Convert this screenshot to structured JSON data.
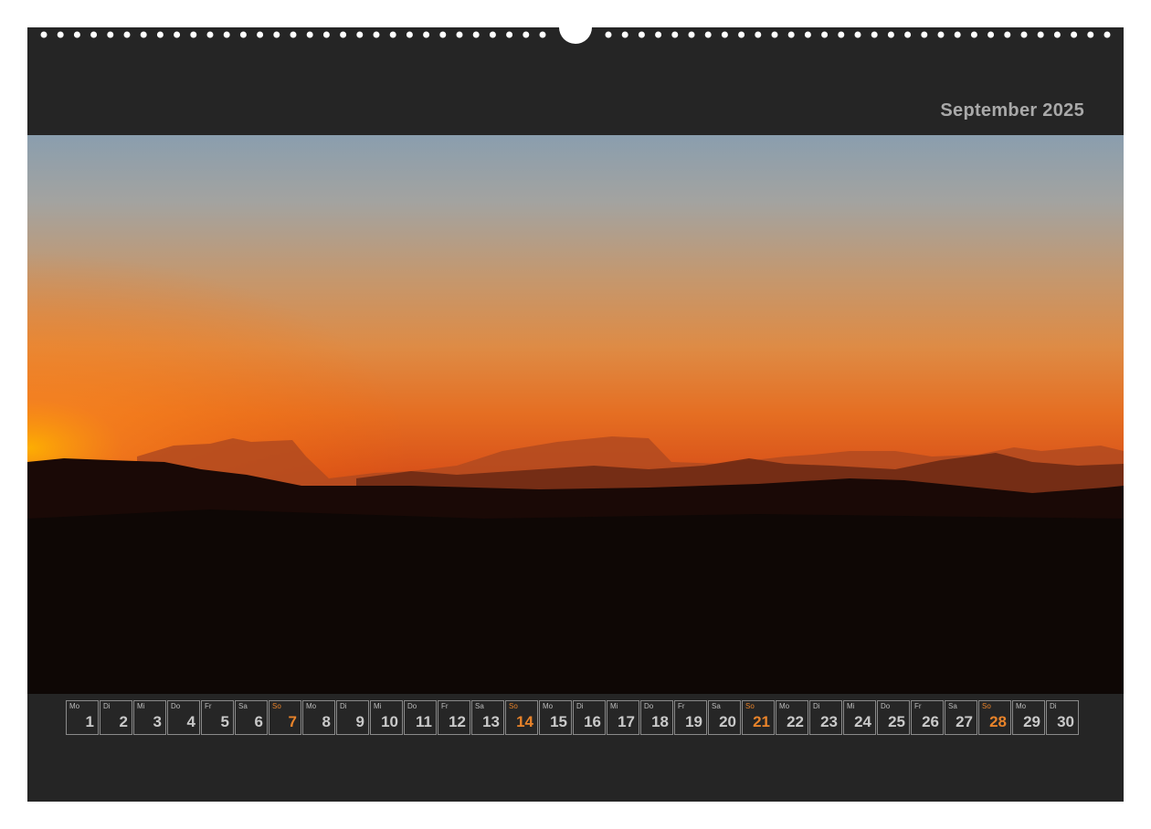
{
  "calendar": {
    "month_title": "September 2025",
    "colors": {
      "page_background": "#252525",
      "text": "#a9a9a9",
      "sunday_accent": "#e8832a"
    },
    "days": [
      {
        "weekday": "Mo",
        "day": "1"
      },
      {
        "weekday": "Di",
        "day": "2"
      },
      {
        "weekday": "Mi",
        "day": "3"
      },
      {
        "weekday": "Do",
        "day": "4"
      },
      {
        "weekday": "Fr",
        "day": "5"
      },
      {
        "weekday": "Sa",
        "day": "6"
      },
      {
        "weekday": "So",
        "day": "7"
      },
      {
        "weekday": "Mo",
        "day": "8"
      },
      {
        "weekday": "Di",
        "day": "9"
      },
      {
        "weekday": "Mi",
        "day": "10"
      },
      {
        "weekday": "Do",
        "day": "11"
      },
      {
        "weekday": "Fr",
        "day": "12"
      },
      {
        "weekday": "Sa",
        "day": "13"
      },
      {
        "weekday": "So",
        "day": "14"
      },
      {
        "weekday": "Mo",
        "day": "15"
      },
      {
        "weekday": "Di",
        "day": "16"
      },
      {
        "weekday": "Mi",
        "day": "17"
      },
      {
        "weekday": "Do",
        "day": "18"
      },
      {
        "weekday": "Fr",
        "day": "19"
      },
      {
        "weekday": "Sa",
        "day": "20"
      },
      {
        "weekday": "So",
        "day": "21"
      },
      {
        "weekday": "Mo",
        "day": "22"
      },
      {
        "weekday": "Di",
        "day": "23"
      },
      {
        "weekday": "Mi",
        "day": "24"
      },
      {
        "weekday": "Do",
        "day": "25"
      },
      {
        "weekday": "Fr",
        "day": "26"
      },
      {
        "weekday": "Sa",
        "day": "27"
      },
      {
        "weekday": "So",
        "day": "28"
      },
      {
        "weekday": "Mo",
        "day": "29"
      },
      {
        "weekday": "Di",
        "day": "30"
      }
    ]
  },
  "photo": {
    "subject": "sunset-mountain-silhouettes"
  }
}
